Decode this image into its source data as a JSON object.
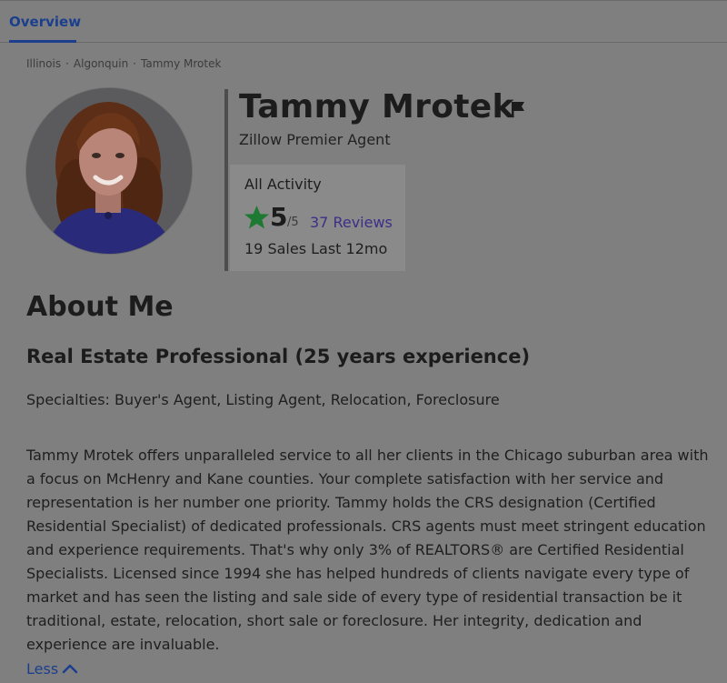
{
  "tabs": [
    {
      "label": "Overview",
      "active": true
    }
  ],
  "breadcrumb": [
    "Illinois",
    "Algonquin",
    "Tammy Mrotek"
  ],
  "breadcrumb_sep": "·",
  "agent": {
    "name": "Tammy Mrotek",
    "type": "Zillow Premier Agent",
    "icons": {
      "flag": "flag-icon",
      "star": "star-icon"
    }
  },
  "activity": {
    "title": "All Activity",
    "rating": "5",
    "rating_max": "/5",
    "reviews": "37 Reviews",
    "sales": "19 Sales Last 12mo"
  },
  "about": {
    "title": "About Me",
    "subtitle": "Real Estate Professional (25 years experience)",
    "specialties": "Specialties: Buyer's Agent, Listing Agent, Relocation, Foreclosure",
    "bio": "Tammy Mrotek offers unparalleled service to all her clients in the Chicago suburban area with\na  focus on McHenry and Kane counties.  Your complete satisfaction with her service and\nrepresentation is her number one priority.  Tammy holds the CRS designation (Certified\nResidential Specialist) of dedicated professionals.  CRS agents must meet stringent education\nand experience requirements. That's why only 3% of REALTORS® are Certified Residential\nSpecialists. Licensed since 1994 she has helped hundreds of clients navigate every type of\nmarket and has seen the listing and sale side of every type of residential transaction be it\ntraditional, estate, relocation, short sale or foreclosure.  Her integrity, dedication and\nexperience are invaluable.",
    "less_label": "Less"
  },
  "colors": {
    "link": "#1b3f8c",
    "reviews_link": "#3c2f86",
    "star": "#1e7a33",
    "overlay_bg": "#7f7f80"
  }
}
